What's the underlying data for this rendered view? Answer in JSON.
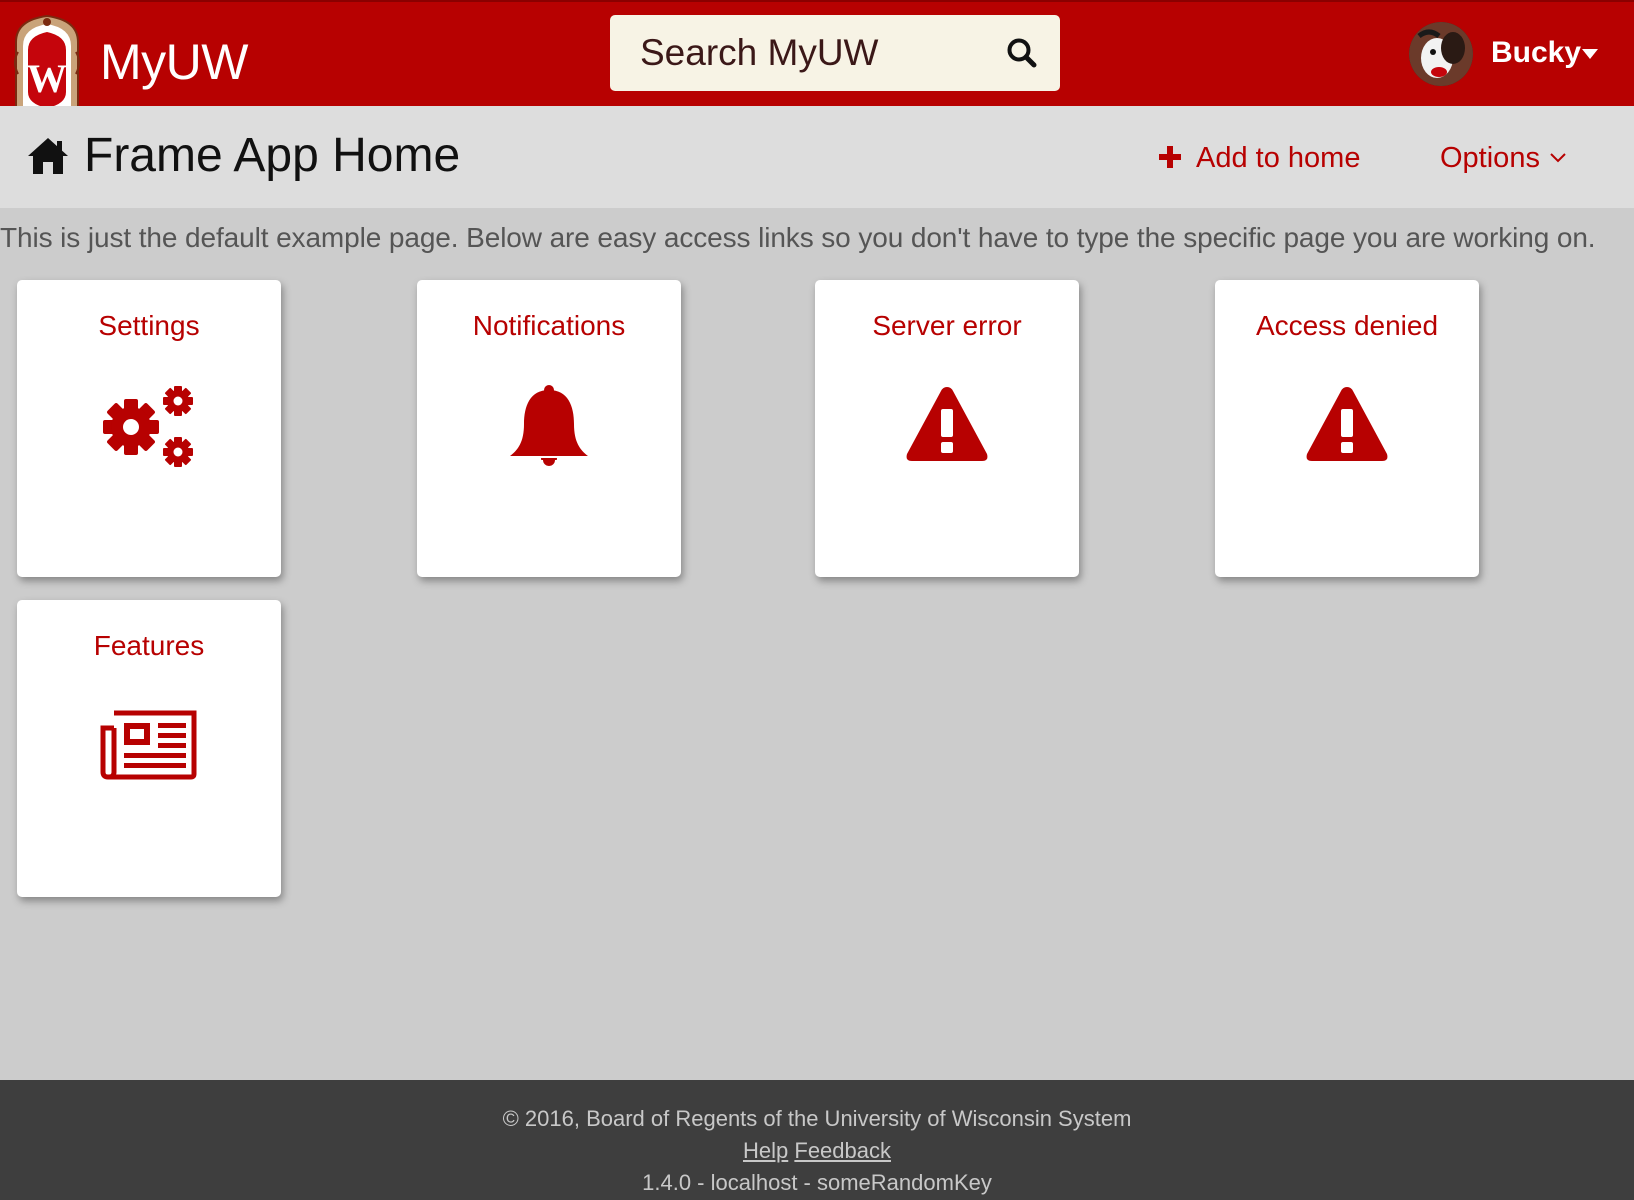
{
  "header": {
    "brand": "MyUW",
    "search_placeholder": "Search MyUW",
    "user_name": "Bucky"
  },
  "title_bar": {
    "title": "Frame App Home",
    "add_to_home": "Add to home",
    "options": "Options"
  },
  "intro": "This is just the default example page. Below are easy access links so you don't have to type the specific page you are working on.",
  "cards": [
    {
      "title": "Settings",
      "icon": "gears-icon"
    },
    {
      "title": "Notifications",
      "icon": "bell-icon"
    },
    {
      "title": "Server error",
      "icon": "warning-icon"
    },
    {
      "title": "Access denied",
      "icon": "warning-icon"
    },
    {
      "title": "Features",
      "icon": "newspaper-icon"
    }
  ],
  "footer": {
    "copyright": "© 2016, Board of Regents of the University of Wisconsin System",
    "help": "Help",
    "feedback": "Feedback",
    "version": "1.4.0 - localhost - someRandomKey"
  },
  "colors": {
    "brand_red": "#b70101",
    "title_bar_bg": "#dddddd",
    "content_bg": "#cccccc",
    "footer_bg": "#3e3e3e",
    "search_bg": "#f7f3e5"
  }
}
